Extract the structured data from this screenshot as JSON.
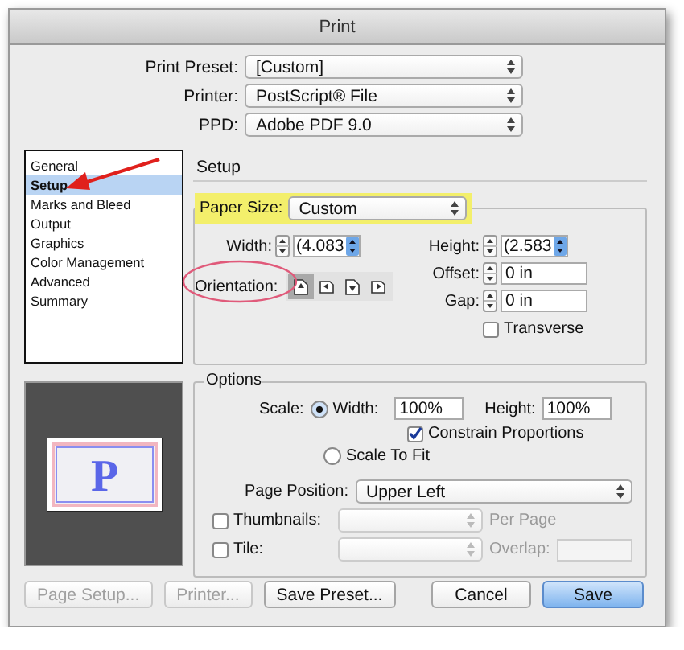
{
  "window": {
    "title": "Print"
  },
  "presets": [
    {
      "label": "Print Preset:",
      "value": "[Custom]"
    },
    {
      "label": "Printer:",
      "value": "PostScript® File"
    },
    {
      "label": "PPD:",
      "value": "Adobe PDF 9.0"
    }
  ],
  "sidebar": {
    "arrow": true,
    "items": [
      {
        "label": "General",
        "selected": false
      },
      {
        "label": "Setup",
        "selected": true
      },
      {
        "label": "Marks and Bleed",
        "selected": false
      },
      {
        "label": "Output",
        "selected": false
      },
      {
        "label": "Graphics",
        "selected": false
      },
      {
        "label": "Color Management",
        "selected": false
      },
      {
        "label": "Advanced",
        "selected": false
      },
      {
        "label": "Summary",
        "selected": false
      }
    ]
  },
  "preview": {
    "glyph": "P"
  },
  "setup": {
    "heading": "Setup",
    "paper_size": {
      "label": "Paper Size:",
      "value": "Custom",
      "highlighted": true
    },
    "width": {
      "label": "Width:",
      "value": "(4.083"
    },
    "height": {
      "label": "Height:",
      "value": "(2.583"
    },
    "offset": {
      "label": "Offset:",
      "value": "0 in"
    },
    "gap": {
      "label": "Gap:",
      "value": "0 in"
    },
    "orientation": {
      "label": "Orientation:",
      "circled": true,
      "buttons": [
        {
          "selected": true
        },
        {
          "selected": false
        },
        {
          "selected": false
        },
        {
          "selected": false
        }
      ]
    },
    "transverse": {
      "label": "Transverse",
      "checked": false
    }
  },
  "options": {
    "legend": "Options",
    "scale_label": "Scale:",
    "scale_width": {
      "label": "Width:",
      "selected": true,
      "value": "100%"
    },
    "scale_height": {
      "label": "Height:",
      "value": "100%"
    },
    "constrain": {
      "label": "Constrain Proportions",
      "checked": true
    },
    "scale_to_fit": {
      "label": "Scale To Fit",
      "selected": false
    },
    "page_position": {
      "label": "Page Position:",
      "value": "Upper Left"
    },
    "thumbnails": {
      "label": "Thumbnails:",
      "checked": false,
      "suffix": "Per Page"
    },
    "tile": {
      "label": "Tile:",
      "checked": false,
      "overlap_label": "Overlap:"
    }
  },
  "buttons": [
    {
      "label": "Page Setup...",
      "kind": "normal",
      "disabled": true
    },
    {
      "label": "Printer...",
      "kind": "normal",
      "disabled": true
    },
    {
      "label": "Save Preset...",
      "kind": "normal",
      "disabled": false
    },
    {
      "label": "Cancel",
      "kind": "normal",
      "disabled": false
    },
    {
      "label": "Save",
      "kind": "default",
      "disabled": false
    }
  ]
}
